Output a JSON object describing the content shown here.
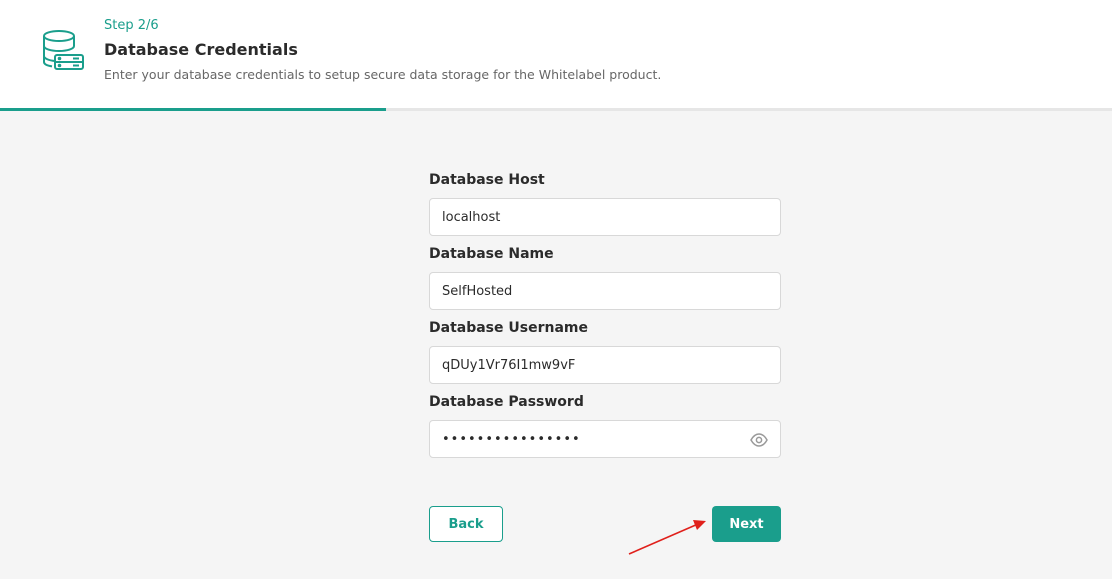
{
  "header": {
    "step": "Step 2/6",
    "title": "Database Credentials",
    "subtitle": "Enter your database credentials to setup secure data storage for the Whitelabel product.",
    "icon": "database-server-icon"
  },
  "progress": {
    "fraction": 0.347,
    "color": "#1a9e8c"
  },
  "form": {
    "fields": [
      {
        "label": "Database Host",
        "value": "localhost"
      },
      {
        "label": "Database Name",
        "value": "SelfHosted"
      },
      {
        "label": "Database Username",
        "value": "qDUy1Vr76I1mw9vF"
      },
      {
        "label": "Database Password",
        "value": "••••••••••••••••",
        "toggle_icon": "eye-icon"
      }
    ]
  },
  "buttons": {
    "back_label": "Back",
    "next_label": "Next"
  },
  "colors": {
    "accent": "#1a9e8c",
    "annotation_arrow": "#e0201b"
  }
}
